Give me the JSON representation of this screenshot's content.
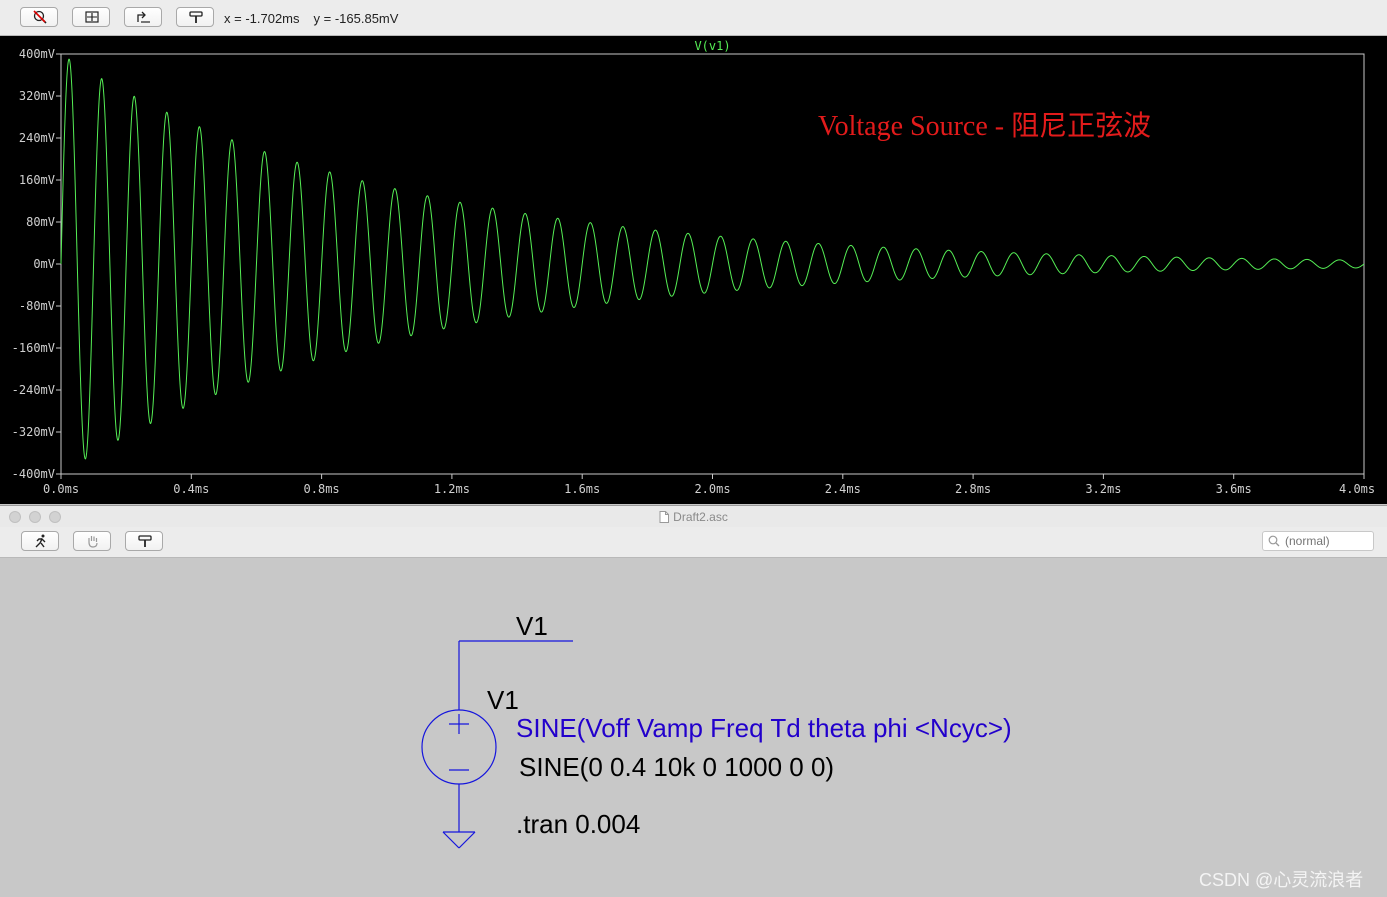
{
  "wave_window": {
    "toolbar_icons": [
      "zoom-cancel-icon",
      "autorange-icon",
      "zoom-back-icon",
      "probe-icon"
    ],
    "cursor_x": "x = -1.702ms",
    "cursor_y": "y = -165.85mV"
  },
  "chart_data": {
    "type": "line",
    "title": "V(v1)",
    "annotation": "Voltage Source -  阻尼正弦波",
    "xlabel": "",
    "ylabel": "",
    "xlim": [
      0,
      4.0
    ],
    "ylim": [
      -400,
      400
    ],
    "x_ticks": [
      "0.0ms",
      "0.4ms",
      "0.8ms",
      "1.2ms",
      "1.6ms",
      "2.0ms",
      "2.4ms",
      "2.8ms",
      "3.2ms",
      "3.6ms",
      "4.0ms"
    ],
    "y_ticks": [
      "400mV",
      "320mV",
      "240mV",
      "160mV",
      "80mV",
      "0mV",
      "-80mV",
      "-160mV",
      "-240mV",
      "-320mV",
      "-400mV"
    ],
    "grid": false,
    "series": [
      {
        "name": "V(v1)",
        "function": "damped_sine",
        "offset_mV": 0,
        "amplitude_mV": 400,
        "frequency_kHz": 10,
        "delay_ms": 0,
        "theta_per_s": 1000,
        "phi_deg": 0,
        "x_range_ms": [
          0,
          4.0
        ],
        "color": "#55ee55"
      }
    ]
  },
  "schematic_window": {
    "title": "Draft2.asc",
    "toolbar_icons": [
      "run-icon",
      "hand-icon",
      "probe-icon"
    ],
    "search_placeholder": "(normal)",
    "net_label": "V1",
    "component_name": "V1",
    "sine_syntax": "SINE(Voff Vamp Freq Td theta phi <Ncyc>)",
    "sine_value": "SINE(0 0.4 10k 0 1000 0 0)",
    "directive": ".tran 0.004",
    "wire_color": "#1515dd",
    "syntax_color": "#2200cc"
  },
  "watermark": "CSDN @心灵流浪者"
}
